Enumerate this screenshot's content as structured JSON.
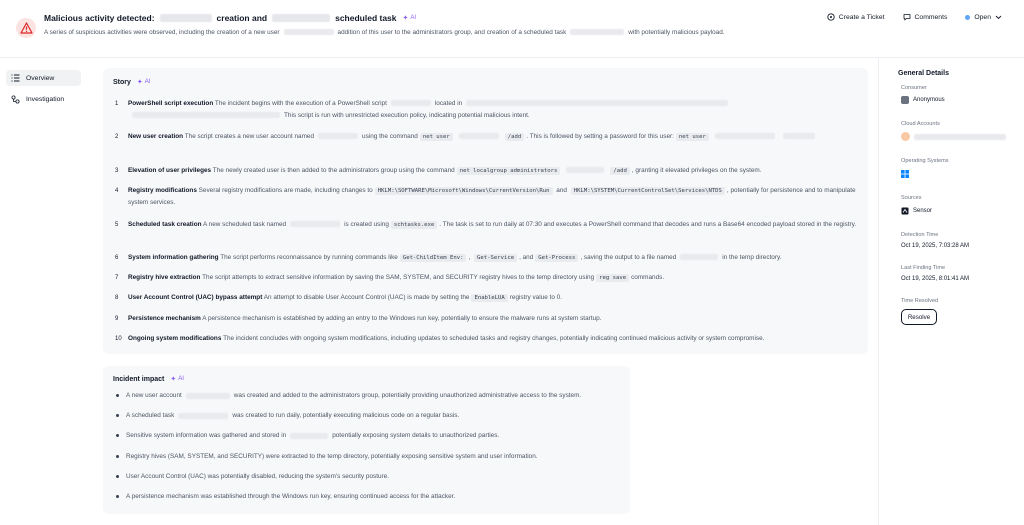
{
  "header": {
    "title_prefix": "Malicious activity detected:",
    "title_mid": "creation and",
    "title_suffix": "scheduled task",
    "ai_label": "AI",
    "summary_a": "A series of suspicious activities were observed, including the creation of a new user",
    "summary_b": "addition of this user to the administrators group, and creation of a scheduled task",
    "summary_c": "with potentially malicious payload.",
    "create_ticket": "Create a Ticket",
    "comments": "Comments",
    "status": "Open"
  },
  "nav": {
    "overview": "Overview",
    "investigation": "Investigation"
  },
  "story": {
    "title": "Story",
    "ai_label": "AI",
    "items": [
      {
        "num": "1",
        "head": "PowerShell script execution",
        "a": "The incident begins with the execution of a PowerShell script",
        "b": "located in",
        "c": "This script is run with unrestricted execution policy, indicating potential malicious intent."
      },
      {
        "num": "2",
        "head": "New user creation",
        "a": "The script creates a new user account named",
        "b": "using the command",
        "code1": "net user",
        "code2": "/add",
        "c": ". This is followed by setting a password for this user:",
        "code3": "net user"
      },
      {
        "num": "3",
        "head": "Elevation of user privileges",
        "a": "The newly created user is then added to the administrators group using the command",
        "code1": "net localgroup administrators",
        "code2": "/add",
        "c": ", granting it elevated privileges on the system."
      },
      {
        "num": "4",
        "head": "Registry modifications",
        "a": "Several registry modifications are made, including changes to",
        "code1": "HKLM:\\SOFTWARE\\Microsoft\\Windows\\CurrentVersion\\Run",
        "b": "and",
        "code2": "HKLM:\\SYSTEM\\CurrentControlSet\\Services\\NTDS",
        "c": ", potentially for persistence and to manipulate system services."
      },
      {
        "num": "5",
        "head": "Scheduled task creation",
        "a": "A new scheduled task named",
        "b": "is created using",
        "code1": "schtasks.exe",
        "c": ". The task is set to run daily at 07:30 and executes a PowerShell command that decodes and runs a Base64 encoded payload stored in the registry."
      },
      {
        "num": "6",
        "head": "System information gathering",
        "a": "The script performs reconnaissance by running commands like",
        "code1": "Get-ChildItem Env:",
        "code2": "Get-Service",
        "b": ", and",
        "code3": "Get-Process",
        "c": ", saving the output to a file named",
        "d": "in the temp directory."
      },
      {
        "num": "7",
        "head": "Registry hive extraction",
        "a": "The script attempts to extract sensitive information by saving the SAM, SYSTEM, and SECURITY registry hives to the temp directory using",
        "code1": "reg save",
        "c": "commands."
      },
      {
        "num": "8",
        "head": "User Account Control (UAC) bypass attempt",
        "a": "An attempt to disable User Account Control (UAC) is made by setting the",
        "code1": "EnableLUA",
        "c": "registry value to 0."
      },
      {
        "num": "9",
        "head": "Persistence mechanism",
        "a": "A persistence mechanism is established by adding an entry to the Windows run key, potentially to ensure the malware runs at system startup."
      },
      {
        "num": "10",
        "head": "Ongoing system modifications",
        "a": "The incident concludes with ongoing system modifications, including updates to scheduled tasks and registry changes, potentially indicating continued malicious activity or system compromise."
      }
    ]
  },
  "impact": {
    "title": "Incident impact",
    "ai_label": "AI",
    "items": [
      {
        "a": "A new user account",
        "b": "was created and added to the administrators group, potentially providing unauthorized administrative access to the system."
      },
      {
        "a": "A scheduled task",
        "b": "was created to run daily, potentially executing malicious code on a regular basis."
      },
      {
        "a": "Sensitive system information was gathered and stored in",
        "b": "potentially exposing system details to unauthorized parties."
      },
      {
        "a": "Registry hives (SAM, SYSTEM, and SECURITY) were extracted to the temp directory, potentially exposing sensitive system and user information."
      },
      {
        "a": "User Account Control (UAC) was potentially disabled, reducing the system's security posture."
      },
      {
        "a": "A persistence mechanism was established through the Windows run key, ensuring continued access for the attacker."
      }
    ]
  },
  "details": {
    "title": "General Details",
    "consumer_label": "Consumer",
    "consumer_value": "Anonymous",
    "cloud_label": "Cloud Accounts",
    "os_label": "Operating Systems",
    "sources_label": "Sources",
    "sources_value": "Sensor",
    "detection_label": "Detection Time",
    "detection_value": "Oct 19, 2025, 7:03:28 AM",
    "last_label": "Last Finding Time",
    "last_value": "Oct 19, 2025, 8:01:41 AM",
    "resolved_label": "Time Resolved",
    "resolve_button": "Resolve"
  },
  "colors": {
    "accent": "#8b5cf6",
    "alert": "#dc2626",
    "alert_bg": "#fbe3e2",
    "status_dot": "#60a5fa",
    "card_bg": "#f7f8fa"
  }
}
